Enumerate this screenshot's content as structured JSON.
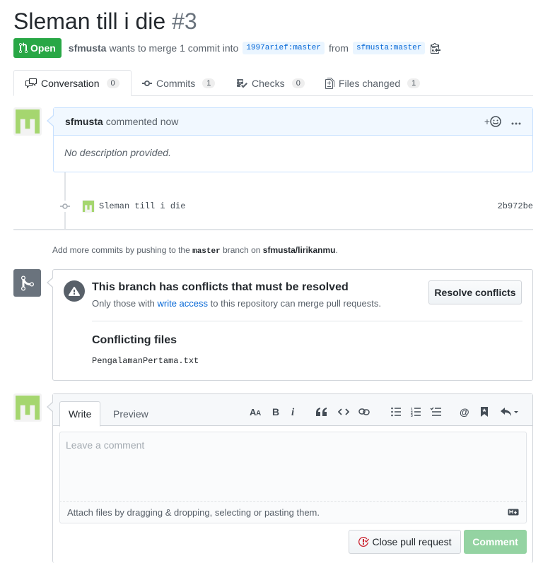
{
  "pr": {
    "title": "Sleman till i die",
    "number": "#3",
    "state": "Open",
    "author": "sfmusta",
    "merge_text": "wants to merge 1 commit into",
    "base_branch": "1997arief:master",
    "from_text": "from",
    "head_branch": "sfmusta:master"
  },
  "tabs": [
    {
      "label": "Conversation",
      "count": "0"
    },
    {
      "label": "Commits",
      "count": "1"
    },
    {
      "label": "Checks",
      "count": "0"
    },
    {
      "label": "Files changed",
      "count": "1"
    }
  ],
  "comment": {
    "author": "sfmusta",
    "action": "commented now",
    "body": "No description provided."
  },
  "commit": {
    "message": "Sleman till i die",
    "sha": "2b972be"
  },
  "add_commits": {
    "prefix": "Add more commits by pushing to the",
    "branch": "master",
    "middle": "branch on",
    "repo": "sfmusta/lirikanmu",
    "suffix": "."
  },
  "merge": {
    "title": "This branch has conflicts that must be resolved",
    "sub_prefix": "Only those with",
    "sub_link": "write access",
    "sub_suffix": "to this repository can merge pull requests.",
    "resolve_button": "Resolve conflicts",
    "files_title": "Conflicting files",
    "files": [
      "PengalamanPertama.txt"
    ]
  },
  "composer": {
    "tab_write": "Write",
    "tab_preview": "Preview",
    "placeholder": "Leave a comment",
    "attach_text": "Attach files by dragging & dropping, selecting or pasting them.",
    "close_button": "Close pull request",
    "comment_button": "Comment"
  },
  "colors": {
    "open_green": "#28a745",
    "link_blue": "#0366d6",
    "comment_disabled": "#94d3a2"
  }
}
